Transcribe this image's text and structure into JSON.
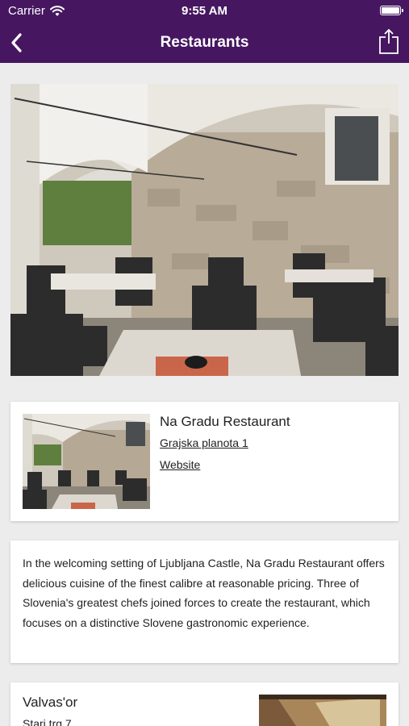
{
  "status_bar": {
    "carrier": "Carrier",
    "time": "9:55 AM"
  },
  "nav": {
    "title": "Restaurants",
    "back_icon": "chevron-left-icon",
    "share_icon": "share-icon"
  },
  "colors": {
    "header": "#461760",
    "background": "#ececec",
    "card": "#ffffff"
  },
  "restaurant": {
    "name": "Na Gradu Restaurant",
    "address": "Grajska planota 1",
    "website_label": "Website",
    "description": "In the welcoming setting of Ljubljana Castle, Na Gradu Restaurant offers delicious cuisine of the finest calibre at reasonable pricing. Three of Slovenia's greatest chefs joined forces to create the restaurant, which focuses on a distinctive Slovene gastronomic experience."
  },
  "next_restaurant": {
    "name": "Valvas'or",
    "address": "Stari trg 7"
  }
}
